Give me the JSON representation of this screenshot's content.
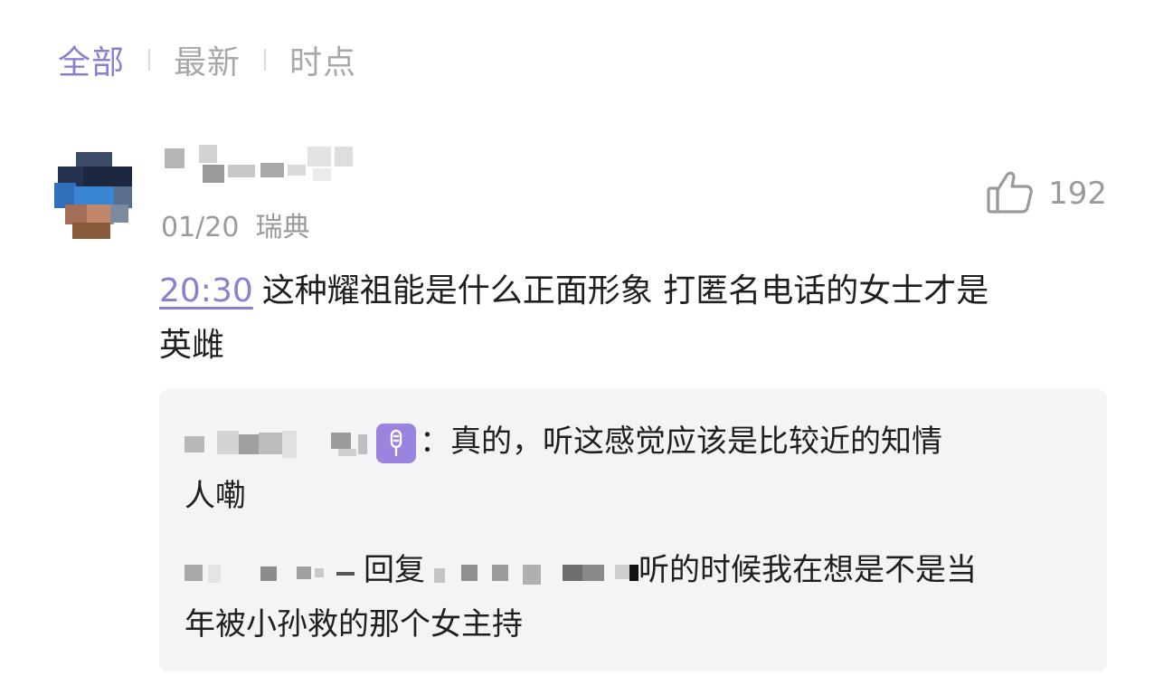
{
  "tabs": [
    {
      "label": "全部",
      "active": true
    },
    {
      "label": "最新",
      "active": false
    },
    {
      "label": "时点",
      "active": false
    }
  ],
  "comment": {
    "date": "01/20",
    "location": "瑞典",
    "likes": "192",
    "timestamp": "20:30",
    "text_line1": "这种耀祖能是什么正面形象 打匿名电话的女士才是",
    "text_line2": "英雌"
  },
  "replies": [
    {
      "text_line1": "：真的，听这感觉应该是比较近的知情",
      "text_line2": "人嘞"
    },
    {
      "reply_word": "回复",
      "text_line1": "听的时候我在想是不是当",
      "text_line2": "年被小孙救的那个女主持"
    }
  ],
  "icons": {
    "like": "thumbs-up-icon",
    "badge": "microphone-icon"
  },
  "colors": {
    "accent": "#8b7fd1",
    "muted": "#a8a8a8",
    "reply_bg": "#f4f4f6"
  }
}
